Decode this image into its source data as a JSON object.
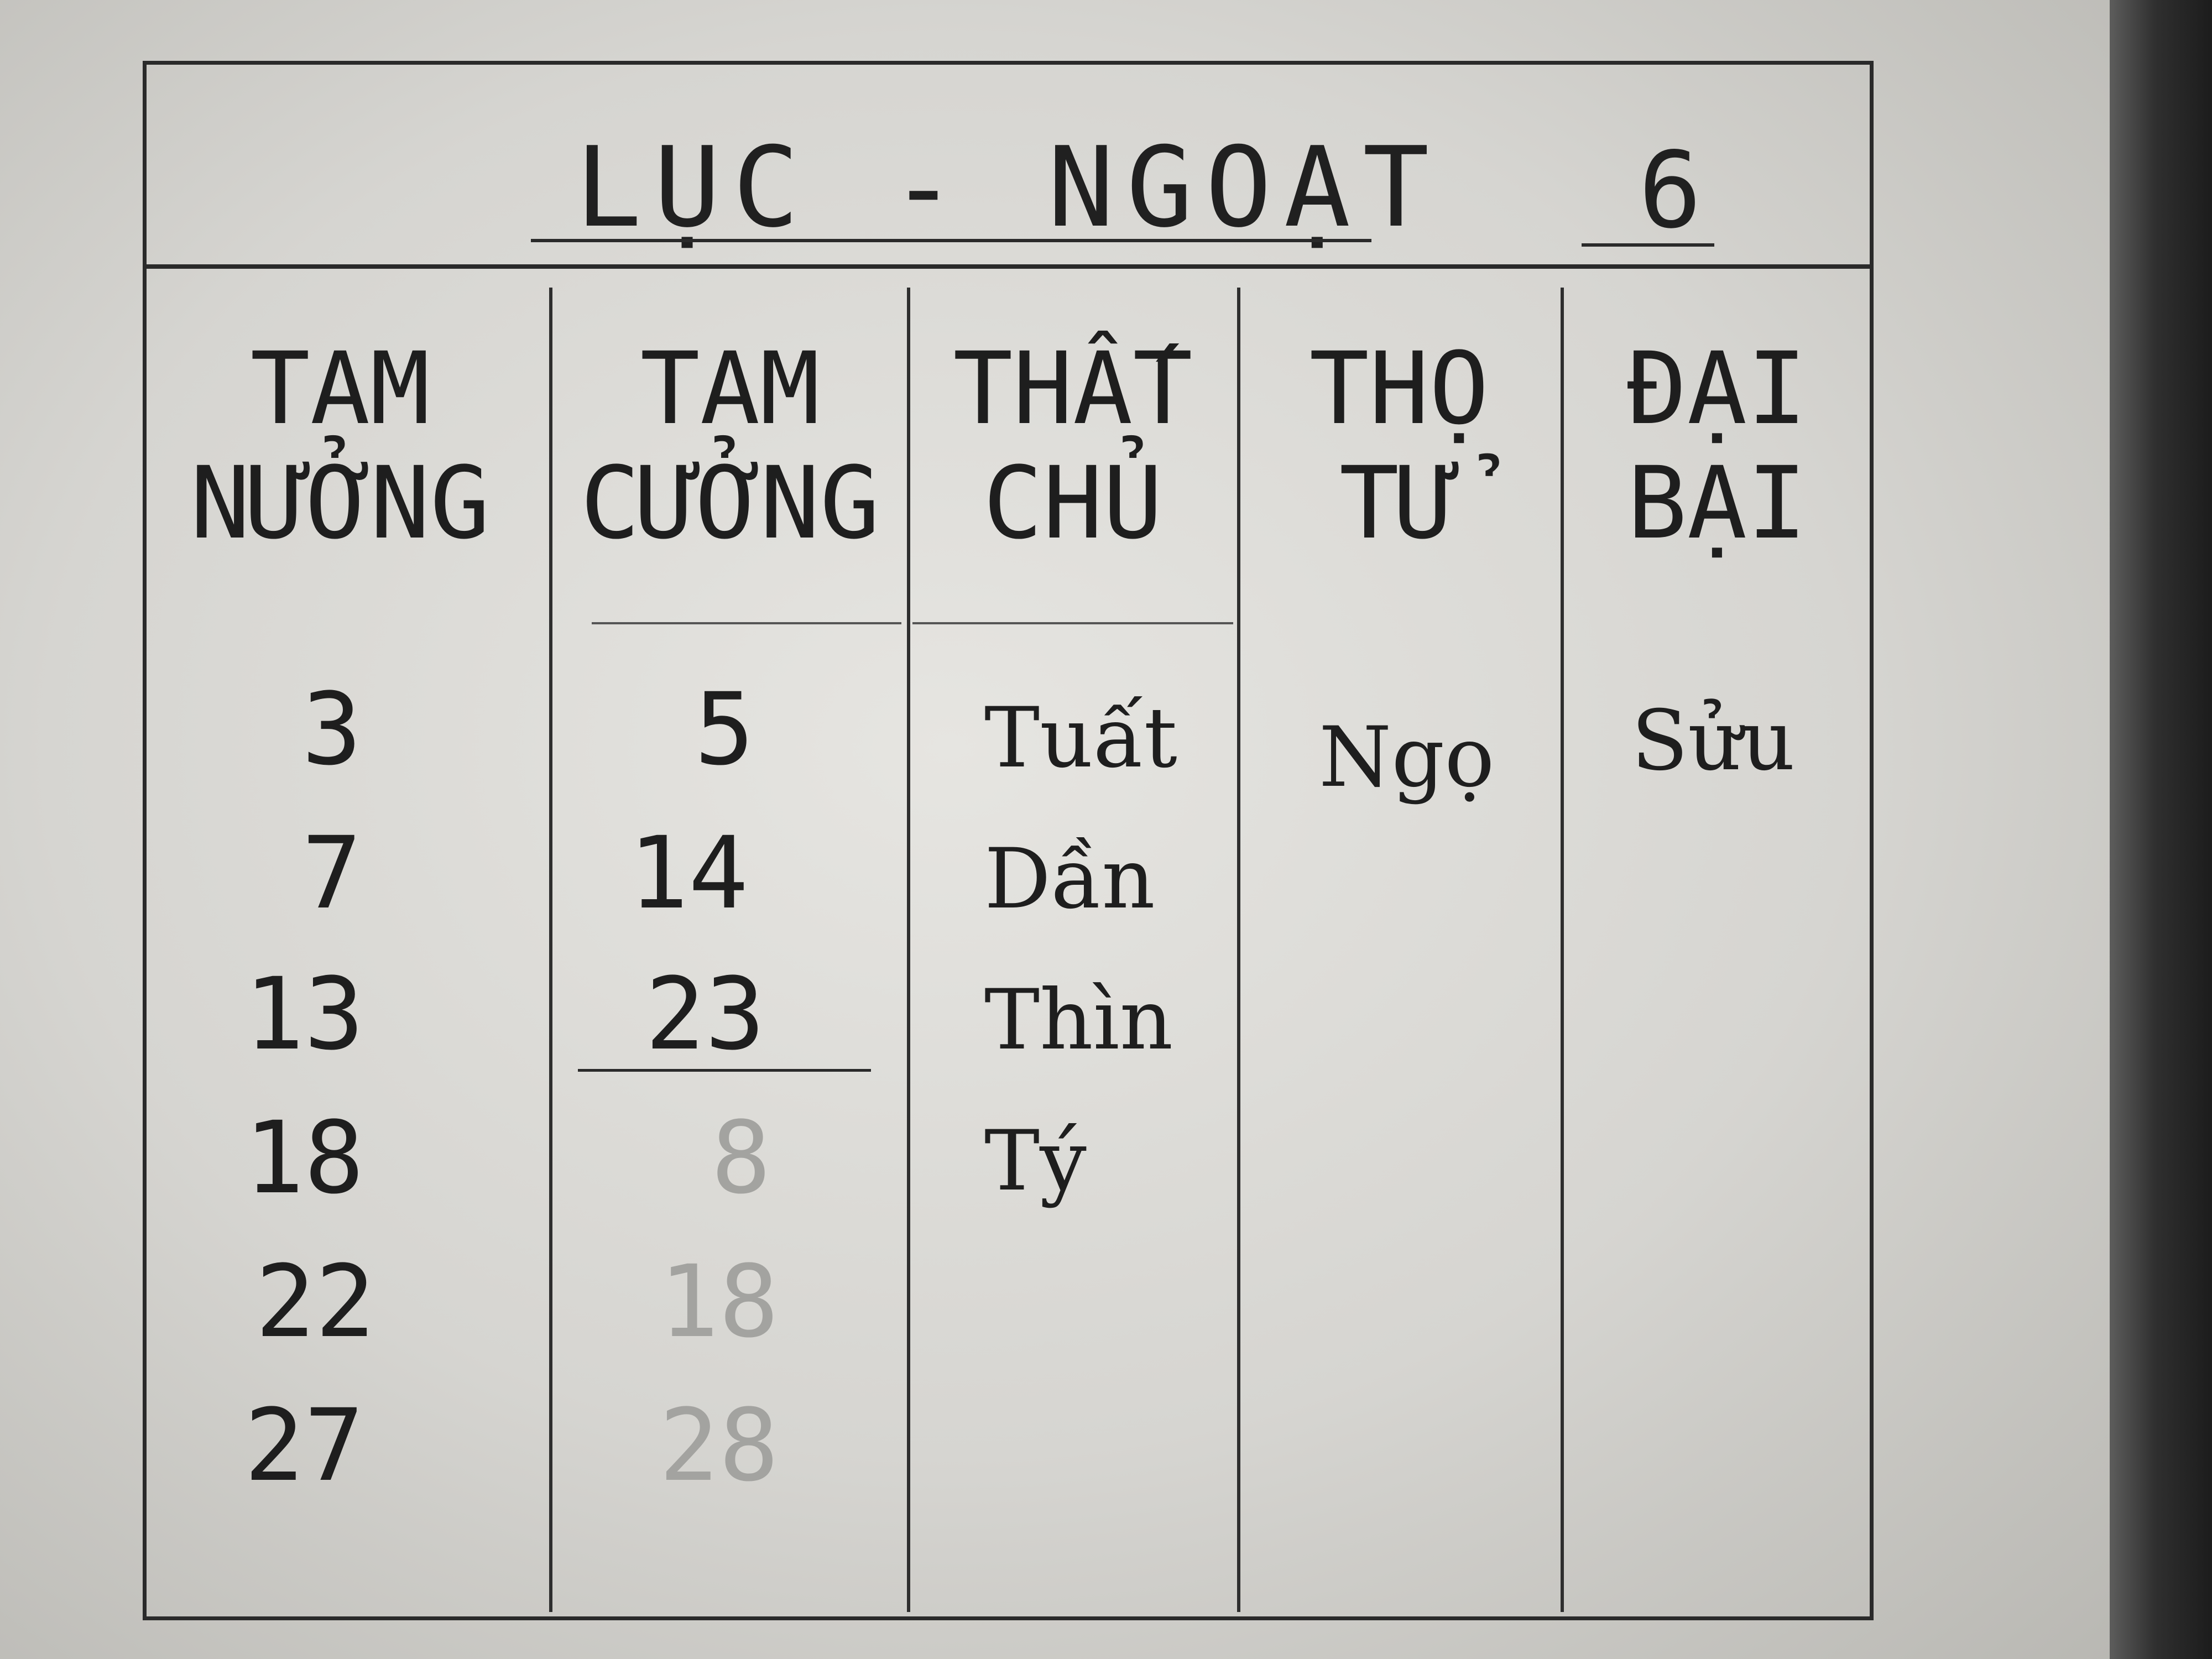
{
  "page": {
    "title": "LỤC - NGOẠT",
    "number": "6"
  },
  "table": {
    "columns": [
      {
        "header": "TAM\nNƯỞNG",
        "values": [
          "3",
          "7",
          "13",
          "18",
          "22",
          "27"
        ]
      },
      {
        "header": "TAM\nCƯỞNG",
        "values": [
          "5",
          "14",
          "23"
        ],
        "faint_values": [
          "8",
          "18",
          "28"
        ]
      },
      {
        "header": "THẤT\nCHỦ",
        "values": [
          "Tuất",
          "Dần",
          "Thìn",
          "Tý"
        ]
      },
      {
        "header": "THỌ\nTỬ",
        "values": [
          "Ngọ"
        ]
      },
      {
        "header": "ĐẠI\nBẠI",
        "values": [
          "Sửu"
        ]
      }
    ]
  }
}
